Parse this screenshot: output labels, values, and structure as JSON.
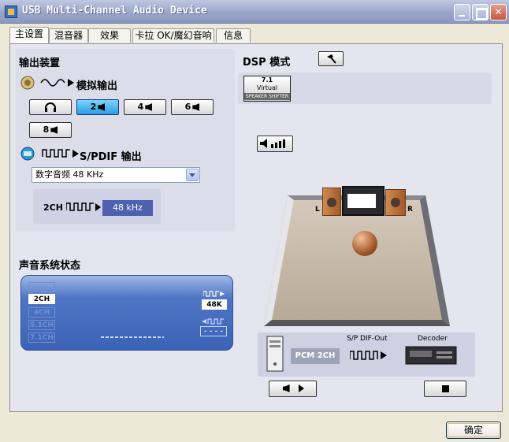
{
  "window": {
    "title": "USB Multi-Channel Audio Device"
  },
  "tabs": [
    {
      "label": "主设置",
      "active": true
    },
    {
      "label": "混音器",
      "active": false
    },
    {
      "label": "效果",
      "active": false
    },
    {
      "label": "卡拉 OK/魔幻音响",
      "active": false
    },
    {
      "label": "信息",
      "active": false
    }
  ],
  "output": {
    "title": "输出装置",
    "analog_label": "模拟输出",
    "channel_buttons": [
      {
        "label": "",
        "icon": "headphones-icon",
        "selected": false
      },
      {
        "label": "2",
        "icon": "speaker-icon",
        "selected": true
      },
      {
        "label": "4",
        "icon": "speaker-icon",
        "selected": false
      },
      {
        "label": "6",
        "icon": "speaker-icon",
        "selected": false
      },
      {
        "label": "8",
        "icon": "speaker-icon",
        "selected": false
      }
    ],
    "spdif_label": "S/PDIF 输出",
    "spdif_select": "数字音频 48 KHz",
    "spdif_channels": "2CH",
    "spdif_rate": "48 kHz"
  },
  "status": {
    "title": "声音系统状态",
    "channel_levels": [
      {
        "label": "",
        "active": false
      },
      {
        "label": "2CH",
        "active": true
      },
      {
        "label": "4CH",
        "active": false
      },
      {
        "label": "5.1CH",
        "active": false
      },
      {
        "label": "7.1CH",
        "active": false
      }
    ],
    "rate_label": "48K",
    "rate_in_placeholder": "- - - -"
  },
  "dsp": {
    "title": "DSP 模式",
    "virtual_line1": "7.1",
    "virtual_line2": "Virtual",
    "virtual_band": "SPEAKER SHIFTER",
    "room_left_label": "L",
    "room_right_label": "R",
    "pcm_label": "PCM 2CH",
    "spdif_out_label": "S/P DIF-Out",
    "decoder_label": "Decoder"
  },
  "footer": {
    "ok_label": "确定"
  },
  "colors": {
    "titlebar": "#9aa6c8",
    "selected_button": "#2a9be0",
    "status_panel": "#3b62b6",
    "rate_chip": "#5060b0"
  }
}
